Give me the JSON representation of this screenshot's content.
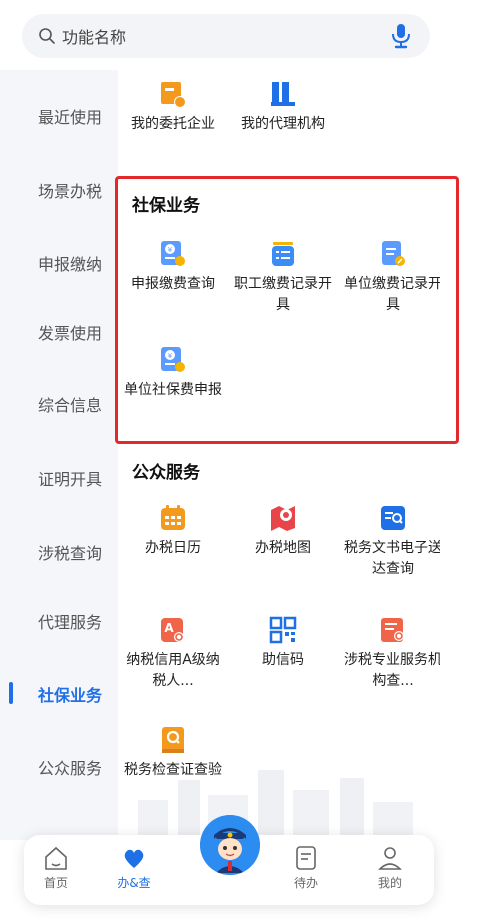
{
  "search": {
    "placeholder": "功能名称",
    "icon": "search-icon",
    "mic_icon": "microphone-icon"
  },
  "sidebar": {
    "items": [
      {
        "label": "最近使用"
      },
      {
        "label": "场景办税"
      },
      {
        "label": "申报缴纳"
      },
      {
        "label": "发票使用"
      },
      {
        "label": "综合信息"
      },
      {
        "label": "证明开具"
      },
      {
        "label": "涉税查询"
      },
      {
        "label": "代理服务"
      },
      {
        "label": "社保业务",
        "active": true
      },
      {
        "label": "公众服务"
      }
    ]
  },
  "top_tiles": [
    {
      "label": "我的委托企业",
      "icon": "entrust-enterprise-icon"
    },
    {
      "label": "我的代理机构",
      "icon": "agency-icon"
    }
  ],
  "social_security": {
    "title": "社保业务",
    "tiles": [
      {
        "label": "申报缴费查询",
        "icon": "payment-query-icon"
      },
      {
        "label": "职工缴费记录开具",
        "icon": "employee-record-icon"
      },
      {
        "label": "单位缴费记录开具",
        "icon": "unit-record-icon"
      },
      {
        "label": "单位社保费申报",
        "icon": "unit-declare-icon"
      }
    ]
  },
  "public_service": {
    "title": "公众服务",
    "tiles": [
      {
        "label": "办税日历",
        "icon": "calendar-icon"
      },
      {
        "label": "办税地图",
        "icon": "map-icon"
      },
      {
        "label": "税务文书电子送达查询",
        "icon": "document-search-icon"
      },
      {
        "label": "纳税信用A级纳税人...",
        "icon": "credit-rating-icon"
      },
      {
        "label": "助信码",
        "icon": "qr-code-icon"
      },
      {
        "label": "涉税专业服务机构查...",
        "icon": "service-agency-icon"
      },
      {
        "label": "税务检查证查验",
        "icon": "inspection-cert-icon"
      }
    ]
  },
  "tabbar": {
    "items": [
      {
        "label": "首页",
        "icon": "home-icon"
      },
      {
        "label": "办&查",
        "icon": "heart-icon",
        "active": true
      },
      {
        "label": "待办",
        "icon": "todo-icon"
      },
      {
        "label": "我的",
        "icon": "user-icon"
      }
    ],
    "center_icon": "assistant-avatar-icon"
  },
  "colors": {
    "accent": "#1f6fe6",
    "highlight": "#e5282c",
    "orange": "#f39a1e",
    "red": "#e8454a"
  }
}
